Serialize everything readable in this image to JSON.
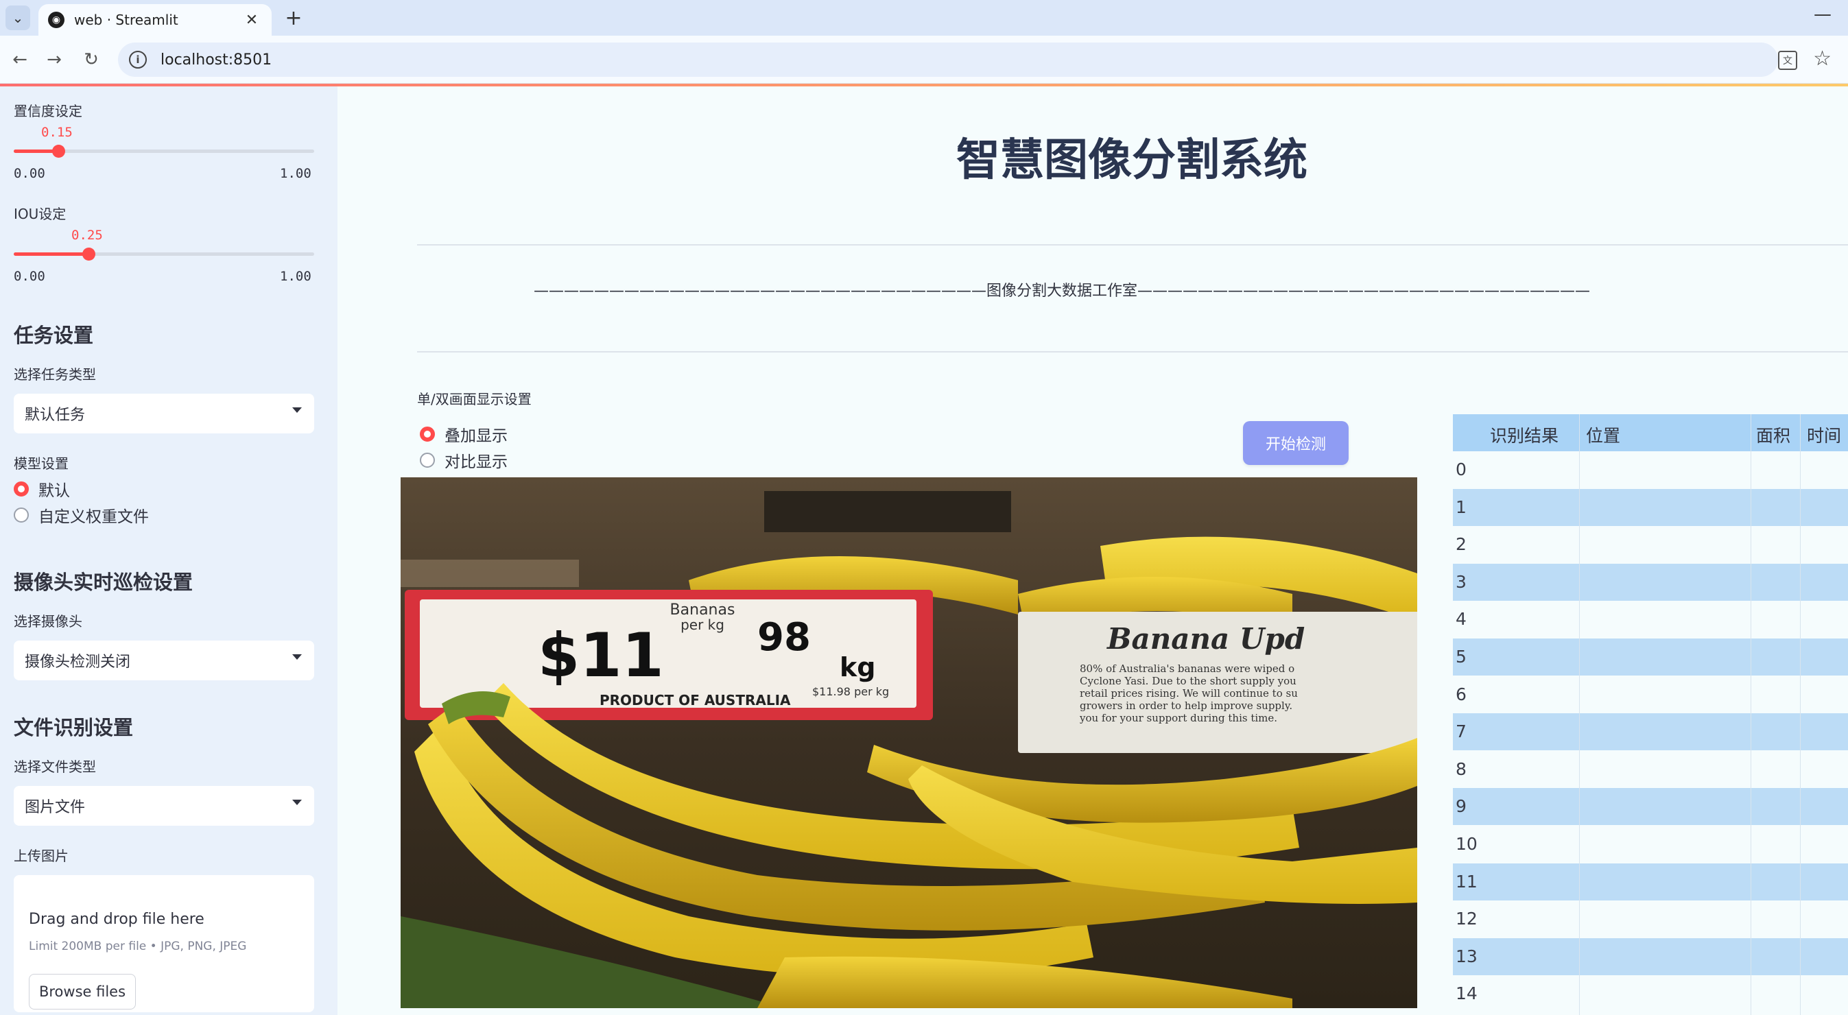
{
  "browser": {
    "tab_title": "web · Streamlit",
    "url": "localhost:8501"
  },
  "sidebar": {
    "confidence": {
      "label": "置信度设定",
      "value": "0.15",
      "min": "0.00",
      "max": "1.00",
      "fraction": 0.15
    },
    "iou": {
      "label": "IOU设定",
      "value": "0.25",
      "min": "0.00",
      "max": "1.00",
      "fraction": 0.25
    },
    "task_section": "任务设置",
    "task_type_label": "选择任务类型",
    "task_type_value": "默认任务",
    "model_label": "模型设置",
    "model_options": [
      "默认",
      "自定义权重文件"
    ],
    "model_selected": "默认",
    "camera_section": "摄像头实时巡检设置",
    "camera_label": "选择摄像头",
    "camera_value": "摄像头检测关闭",
    "file_section": "文件识别设置",
    "file_type_label": "选择文件类型",
    "file_type_value": "图片文件",
    "upload_label": "上传图片",
    "upload_title": "Drag and drop file here",
    "upload_limit": "Limit 200MB per file • JPG, PNG, JPEG",
    "browse_label": "Browse files"
  },
  "main": {
    "title": "智慧图像分割系统",
    "caption": "——————————————————————————————图像分割大数据工作室——————————————————————————————",
    "display_label": "单/双画面显示设置",
    "display_options": [
      "叠加显示",
      "对比显示"
    ],
    "display_selected": "叠加显示",
    "start_button": "开始检测"
  },
  "image": {
    "price_tag_header": "Bananas",
    "price_tag_unit_top": "per kg",
    "price_main": "$11",
    "price_cents": "98",
    "price_unit": "kg",
    "price_per": "$11.98 per kg",
    "price_footer": "PRODUCT OF AUSTRALIA",
    "notice_title": "Banana Upd",
    "notice_lines": [
      "80% of Australia's bananas were wiped o",
      "Cyclone Yasi. Due to the short supply you",
      "retail prices rising. We will continue to su",
      "growers in order to help improve supply.",
      "you for your support during this time."
    ]
  },
  "table": {
    "columns": [
      "识别结果",
      "位置",
      "面积",
      "时间"
    ],
    "rows": [
      "0",
      "1",
      "2",
      "3",
      "4",
      "5",
      "6",
      "7",
      "8",
      "9",
      "10",
      "11",
      "12",
      "13",
      "14"
    ]
  },
  "colors": {
    "accent": "#ff4b4b",
    "button": "#8f9cf3",
    "table_header": "#a9d3f6",
    "table_alt_row": "#bcdcf6",
    "sidebar_bg": "#e9f1fb"
  }
}
